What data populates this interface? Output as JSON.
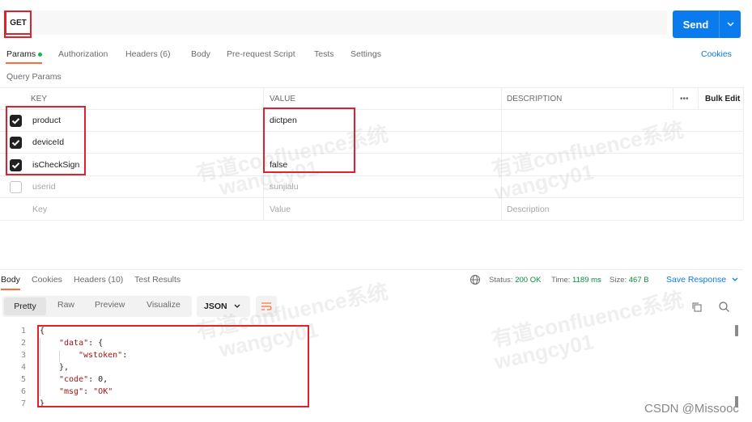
{
  "request": {
    "method": "GET",
    "url": "",
    "send_label": "Send"
  },
  "request_tabs": [
    {
      "label": "Params",
      "active": true,
      "dot": true
    },
    {
      "label": "Authorization"
    },
    {
      "label": "Headers (6)"
    },
    {
      "label": "Body"
    },
    {
      "label": "Pre-request Script"
    },
    {
      "label": "Tests"
    },
    {
      "label": "Settings"
    }
  ],
  "cookies_label": "Cookies",
  "query_params": {
    "title": "Query Params",
    "headers": {
      "key": "KEY",
      "value": "VALUE",
      "description": "DESCRIPTION",
      "more": "•••",
      "bulk_edit": "Bulk Edit"
    },
    "rows": [
      {
        "checked": true,
        "key": "product",
        "value": "dictpen",
        "description": ""
      },
      {
        "checked": true,
        "key": "deviceId",
        "value": "",
        "description": ""
      },
      {
        "checked": true,
        "key": "isCheckSign",
        "value": "false",
        "description": ""
      },
      {
        "checked": false,
        "key": "userid",
        "value": "sunjialu",
        "description": ""
      }
    ],
    "placeholder": {
      "key": "Key",
      "value": "Value",
      "description": "Description"
    }
  },
  "response": {
    "tabs": [
      {
        "label": "Body",
        "active": true
      },
      {
        "label": "Cookies"
      },
      {
        "label": "Headers (10)"
      },
      {
        "label": "Test Results"
      }
    ],
    "status_label": "Status:",
    "status_value": "200 OK",
    "time_label": "Time:",
    "time_value": "1189 ms",
    "size_label": "Size:",
    "size_value": "467 B",
    "save_label": "Save Response",
    "views": [
      "Pretty",
      "Raw",
      "Preview",
      "Visualize"
    ],
    "format": "JSON",
    "lines": [
      "1",
      "2",
      "3",
      "4",
      "5",
      "6",
      "7"
    ],
    "code": {
      "l1": "{",
      "l2_key": "\"data\"",
      "l2_rest": ": {",
      "l3_key": "\"wstoken\"",
      "l3_rest": ":",
      "l4": "},",
      "l5_key": "\"code\"",
      "l5_rest": ": 0,",
      "l6_key": "\"msg\"",
      "l6_sep": ": ",
      "l6_val": "\"OK\"",
      "l7": "}"
    }
  },
  "watermark": {
    "line1": "有道confluence系统",
    "line2": "wangcy01"
  },
  "credit": "CSDN @Missooc",
  "colors": {
    "accent": "#097bed",
    "tab_active": "#ff6c37",
    "highlight": "#e0202c",
    "status_ok": "#0a8a43"
  }
}
